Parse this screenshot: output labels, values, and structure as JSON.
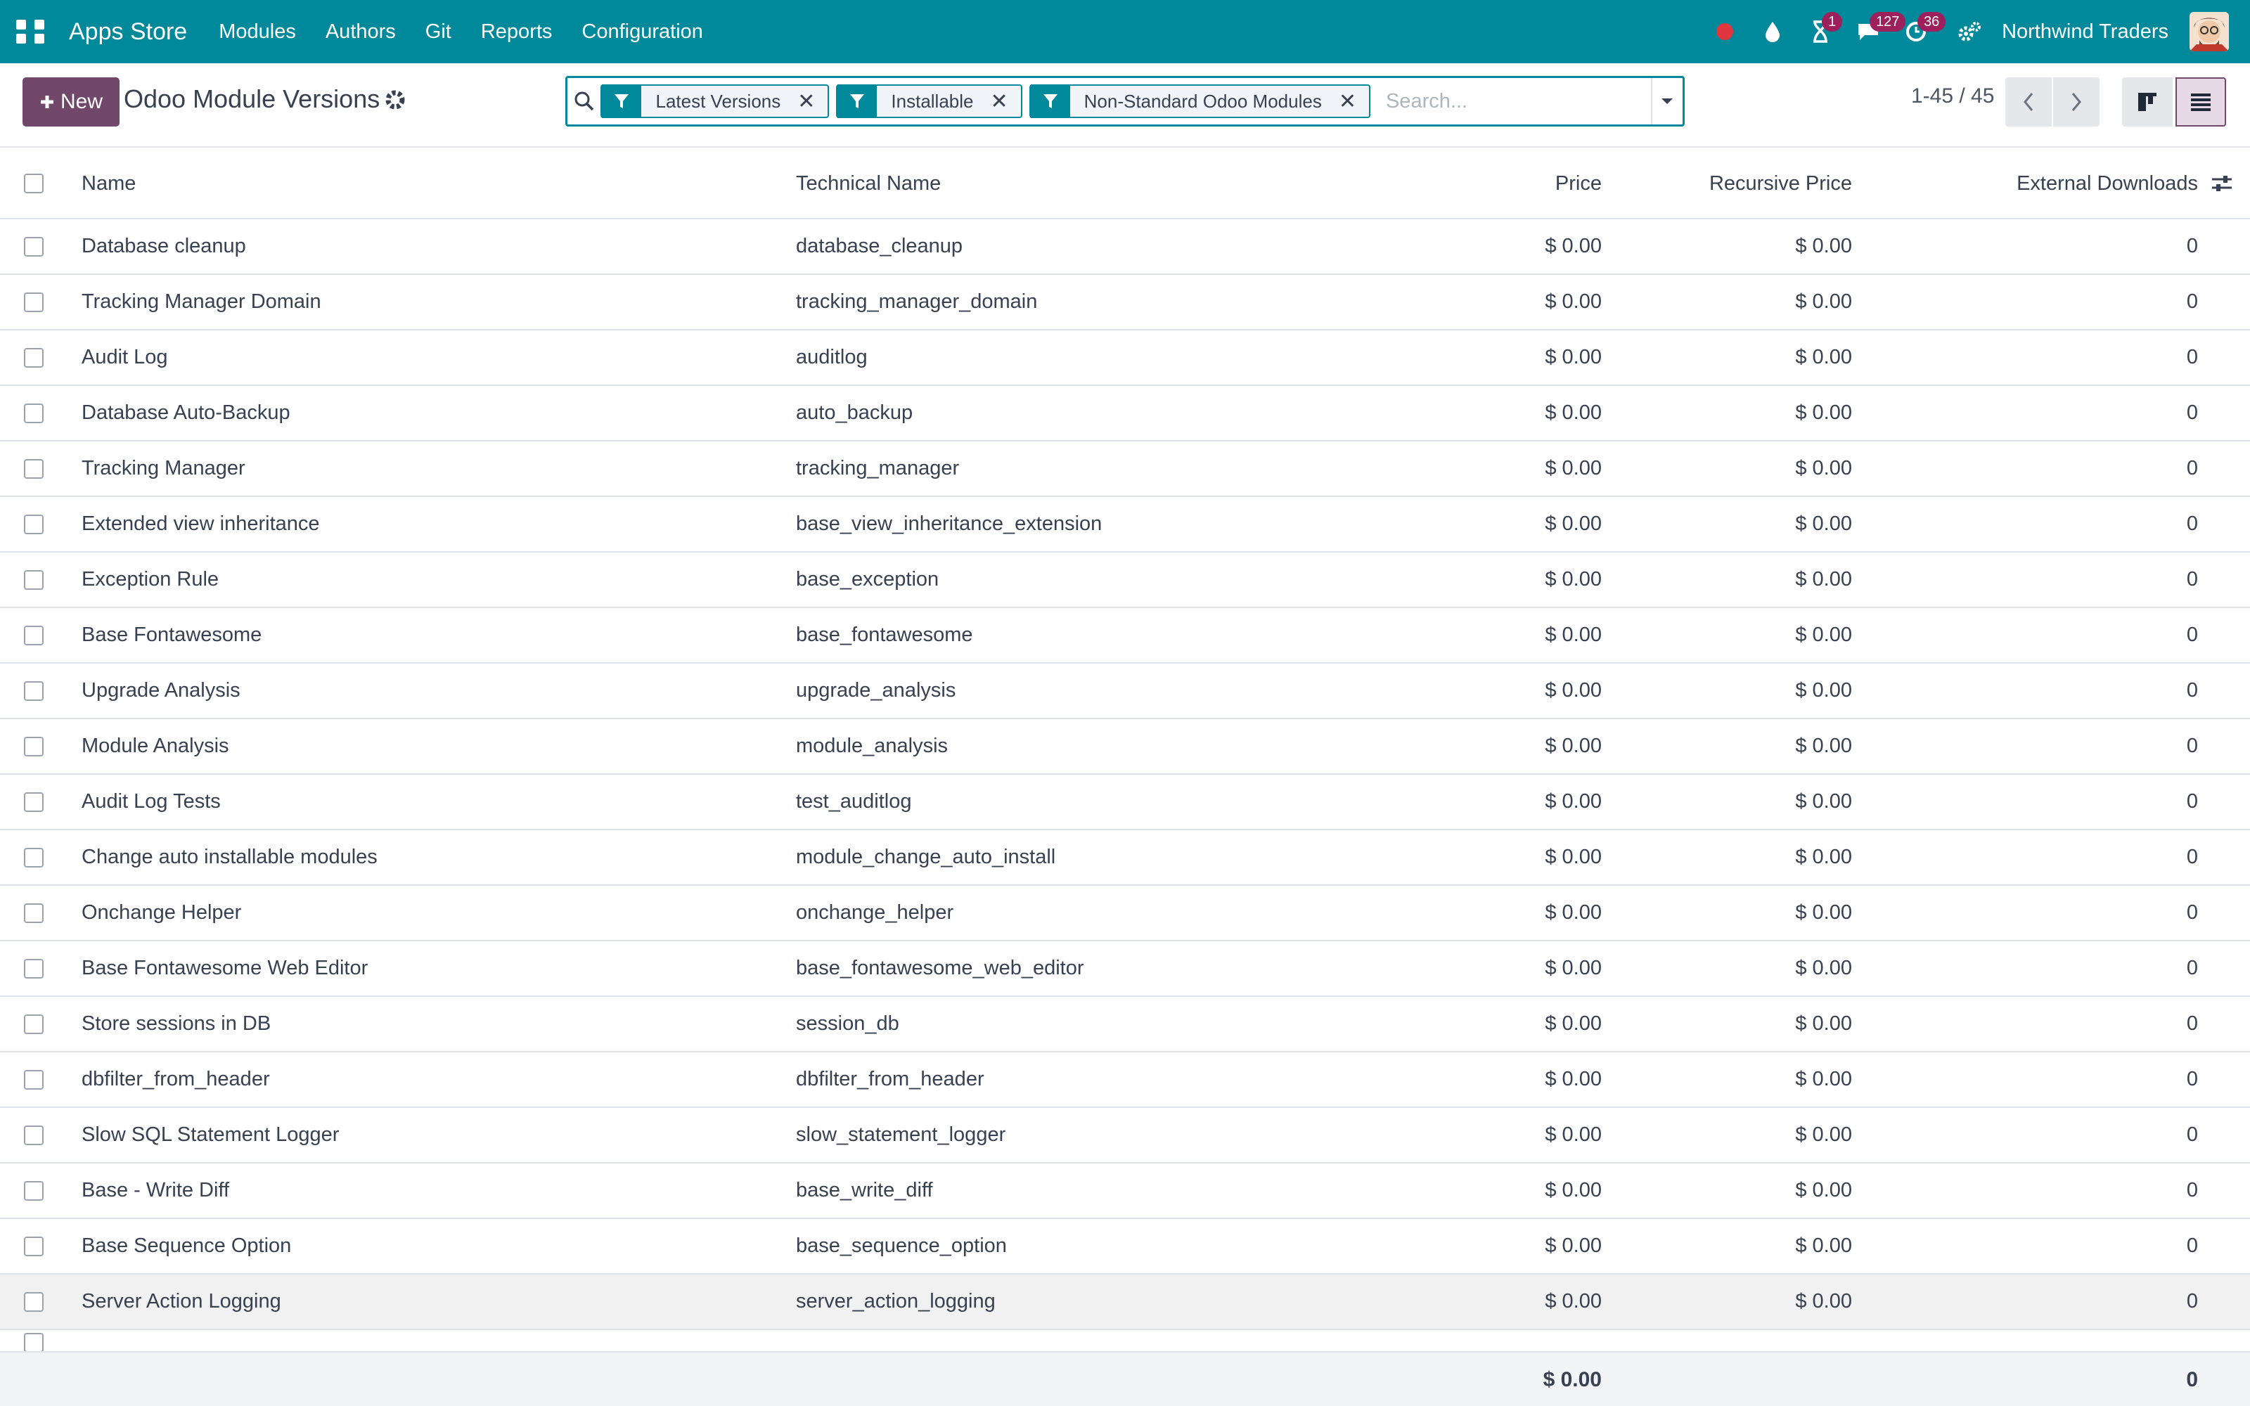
{
  "navbar": {
    "brand": "Apps Store",
    "menu": [
      "Modules",
      "Authors",
      "Git",
      "Reports",
      "Configuration"
    ],
    "badges": {
      "activities": "1",
      "messages": "127",
      "timer": "36"
    },
    "company": "Northwind Traders"
  },
  "control": {
    "new_label": "New",
    "title": "Odoo Module Versions",
    "facets": [
      "Latest Versions",
      "Installable",
      "Non-Standard Odoo Modules"
    ],
    "search_placeholder": "Search...",
    "pager": "1-45 / 45"
  },
  "table": {
    "headers": {
      "name": "Name",
      "technical": "Technical Name",
      "price": "Price",
      "recursive": "Recursive Price",
      "downloads": "External Downloads"
    },
    "rows": [
      {
        "name": "Database cleanup",
        "technical": "database_cleanup",
        "price": "$ 0.00",
        "recursive": "$ 0.00",
        "downloads": "0"
      },
      {
        "name": "Tracking Manager Domain",
        "technical": "tracking_manager_domain",
        "price": "$ 0.00",
        "recursive": "$ 0.00",
        "downloads": "0"
      },
      {
        "name": "Audit Log",
        "technical": "auditlog",
        "price": "$ 0.00",
        "recursive": "$ 0.00",
        "downloads": "0"
      },
      {
        "name": "Database Auto-Backup",
        "technical": "auto_backup",
        "price": "$ 0.00",
        "recursive": "$ 0.00",
        "downloads": "0"
      },
      {
        "name": "Tracking Manager",
        "technical": "tracking_manager",
        "price": "$ 0.00",
        "recursive": "$ 0.00",
        "downloads": "0"
      },
      {
        "name": "Extended view inheritance",
        "technical": "base_view_inheritance_extension",
        "price": "$ 0.00",
        "recursive": "$ 0.00",
        "downloads": "0"
      },
      {
        "name": "Exception Rule",
        "technical": "base_exception",
        "price": "$ 0.00",
        "recursive": "$ 0.00",
        "downloads": "0"
      },
      {
        "name": "Base Fontawesome",
        "technical": "base_fontawesome",
        "price": "$ 0.00",
        "recursive": "$ 0.00",
        "downloads": "0"
      },
      {
        "name": "Upgrade Analysis",
        "technical": "upgrade_analysis",
        "price": "$ 0.00",
        "recursive": "$ 0.00",
        "downloads": "0"
      },
      {
        "name": "Module Analysis",
        "technical": "module_analysis",
        "price": "$ 0.00",
        "recursive": "$ 0.00",
        "downloads": "0"
      },
      {
        "name": "Audit Log Tests",
        "technical": "test_auditlog",
        "price": "$ 0.00",
        "recursive": "$ 0.00",
        "downloads": "0"
      },
      {
        "name": "Change auto installable modules",
        "technical": "module_change_auto_install",
        "price": "$ 0.00",
        "recursive": "$ 0.00",
        "downloads": "0"
      },
      {
        "name": "Onchange Helper",
        "technical": "onchange_helper",
        "price": "$ 0.00",
        "recursive": "$ 0.00",
        "downloads": "0"
      },
      {
        "name": "Base Fontawesome Web Editor",
        "technical": "base_fontawesome_web_editor",
        "price": "$ 0.00",
        "recursive": "$ 0.00",
        "downloads": "0"
      },
      {
        "name": "Store sessions in DB",
        "technical": "session_db",
        "price": "$ 0.00",
        "recursive": "$ 0.00",
        "downloads": "0"
      },
      {
        "name": "dbfilter_from_header",
        "technical": "dbfilter_from_header",
        "price": "$ 0.00",
        "recursive": "$ 0.00",
        "downloads": "0"
      },
      {
        "name": "Slow SQL Statement Logger",
        "technical": "slow_statement_logger",
        "price": "$ 0.00",
        "recursive": "$ 0.00",
        "downloads": "0"
      },
      {
        "name": "Base - Write Diff",
        "technical": "base_write_diff",
        "price": "$ 0.00",
        "recursive": "$ 0.00",
        "downloads": "0"
      },
      {
        "name": "Base Sequence Option",
        "technical": "base_sequence_option",
        "price": "$ 0.00",
        "recursive": "$ 0.00",
        "downloads": "0"
      },
      {
        "name": "Server Action Logging",
        "technical": "server_action_logging",
        "price": "$ 0.00",
        "recursive": "$ 0.00",
        "downloads": "0"
      }
    ],
    "totals": {
      "price": "$ 0.00",
      "downloads": "0"
    }
  }
}
